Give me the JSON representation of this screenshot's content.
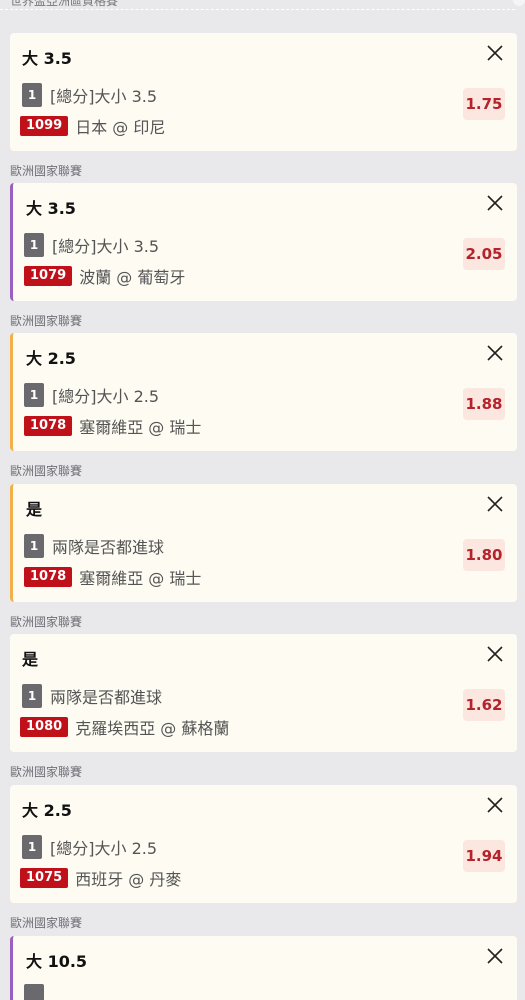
{
  "top_cut_label": "世界盃亞洲區資格賽",
  "colors": {
    "accent_purple": "#9b5fc0",
    "accent_orange": "#f2b04a",
    "id_badge_red": "#c0101a",
    "odds_bg": "#fbe6e0",
    "odds_text": "#b4222a"
  },
  "bets": [
    {
      "league": "",
      "selection": "大 3.5",
      "count": "1",
      "market": "[總分]大小 3.5",
      "match_id": "1099",
      "teams": "日本 @ 印尼",
      "odds": "1.75",
      "accent": "none"
    },
    {
      "league": "歐洲國家聯賽",
      "selection": "大 3.5",
      "count": "1",
      "market": "[總分]大小 3.5",
      "match_id": "1079",
      "teams": "波蘭 @ 葡萄牙",
      "odds": "2.05",
      "accent": "purple"
    },
    {
      "league": "歐洲國家聯賽",
      "selection": "大 2.5",
      "count": "1",
      "market": "[總分]大小 2.5",
      "match_id": "1078",
      "teams": "塞爾維亞 @ 瑞士",
      "odds": "1.88",
      "accent": "orange"
    },
    {
      "league": "歐洲國家聯賽",
      "selection": "是",
      "count": "1",
      "market": "兩隊是否都進球",
      "match_id": "1078",
      "teams": "塞爾維亞 @ 瑞士",
      "odds": "1.80",
      "accent": "orange"
    },
    {
      "league": "歐洲國家聯賽",
      "selection": "是",
      "count": "1",
      "market": "兩隊是否都進球",
      "match_id": "1080",
      "teams": "克羅埃西亞 @ 蘇格蘭",
      "odds": "1.62",
      "accent": "none"
    },
    {
      "league": "歐洲國家聯賽",
      "selection": "大 2.5",
      "count": "1",
      "market": "[總分]大小 2.5",
      "match_id": "1075",
      "teams": "西班牙 @ 丹麥",
      "odds": "1.94",
      "accent": "none"
    },
    {
      "league": "歐洲國家聯賽",
      "selection": "大 10.5",
      "accent": "purple"
    }
  ]
}
